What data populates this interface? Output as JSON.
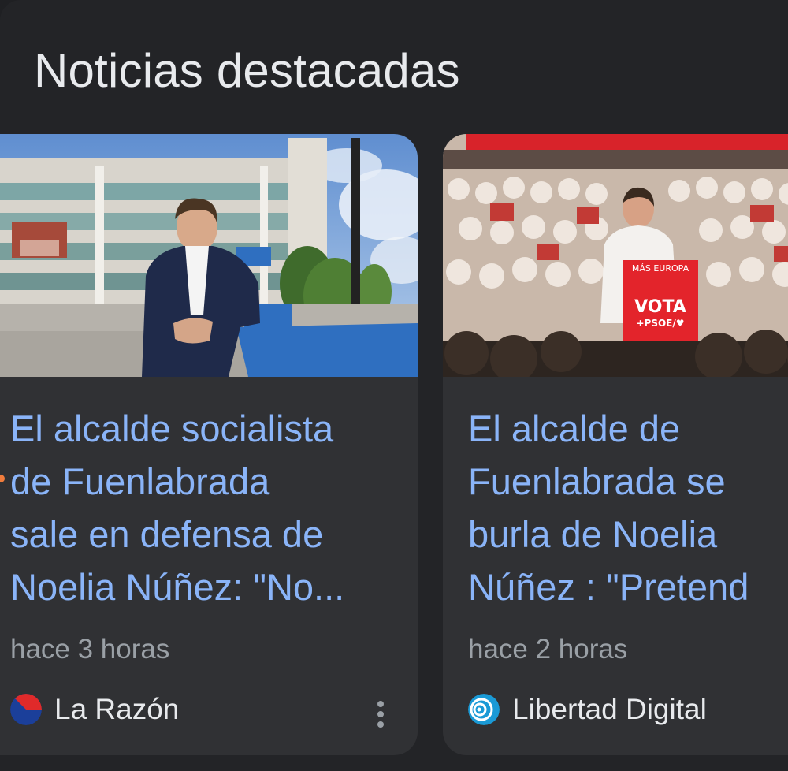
{
  "section": {
    "title": "Noticias destacadas"
  },
  "colors": {
    "background": "#232427",
    "card": "#303134",
    "headline": "#8ab4f8",
    "secondary_text": "#9aa0a6",
    "primary_text": "#e8eaed",
    "unread_indicator": "#f07c3c"
  },
  "articles": [
    {
      "headline_lines": [
        "El alcalde socialista",
        "de Fuenlabrada",
        "sale en defensa de",
        "Noelia Núñez: \"No..."
      ],
      "time": "hace 3 horas",
      "source": "La Razón",
      "source_icon": "la-razon-logo",
      "image": "man-in-suit-leaning-on-railing-in-front-of-office-building",
      "menu_icon": "more-vert-icon"
    },
    {
      "headline_lines": [
        "El alcalde de",
        "Fuenlabrada se",
        "burla de Noelia",
        "Núñez : \"Pretend"
      ],
      "time": "hace 2 horas",
      "source": "Libertad Digital",
      "source_icon": "libertad-digital-logo",
      "image": "politician-speaking-at-rally-lectern",
      "lectern_text": {
        "top": "MÁS EUROPA",
        "main": "VOTA",
        "bottom": "+PSOE/♥"
      }
    }
  ]
}
